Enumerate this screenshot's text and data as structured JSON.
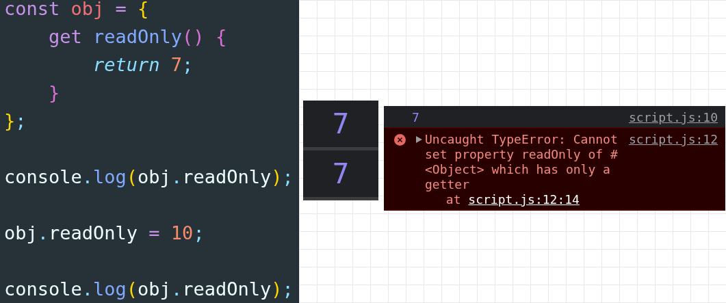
{
  "editor": {
    "lines": [
      {
        "kind": "code",
        "tokens": [
          {
            "text": "const",
            "kind": "keyword"
          },
          {
            "text": " obj",
            "kind": "variable"
          },
          {
            "text": " =",
            "kind": "operator"
          },
          {
            "text": " {",
            "kind": "bracket1"
          }
        ]
      },
      {
        "kind": "code",
        "tokens": [
          {
            "text": "    get",
            "kind": "keyword"
          },
          {
            "text": " readOnly",
            "kind": "function"
          },
          {
            "text": "()",
            "kind": "bracket2"
          },
          {
            "text": " {",
            "kind": "bracket2"
          }
        ]
      },
      {
        "kind": "code",
        "tokens": [
          {
            "text": "        return",
            "kind": "control"
          },
          {
            "text": " 7",
            "kind": "number"
          },
          {
            "text": ";",
            "kind": "punct"
          }
        ]
      },
      {
        "kind": "code",
        "tokens": [
          {
            "text": "    }",
            "kind": "bracket2"
          }
        ]
      },
      {
        "kind": "code",
        "tokens": [
          {
            "text": "}",
            "kind": "bracket1"
          },
          {
            "text": ";",
            "kind": "punct"
          }
        ]
      },
      {
        "kind": "blank"
      },
      {
        "kind": "code",
        "tokens": [
          {
            "text": "console",
            "kind": "plain"
          },
          {
            "text": ".",
            "kind": "punct"
          },
          {
            "text": "log",
            "kind": "function"
          },
          {
            "text": "(",
            "kind": "bracket1"
          },
          {
            "text": "obj",
            "kind": "plain"
          },
          {
            "text": ".",
            "kind": "punct"
          },
          {
            "text": "readOnly",
            "kind": "plain"
          },
          {
            "text": ")",
            "kind": "bracket1"
          },
          {
            "text": ";",
            "kind": "punct"
          }
        ]
      },
      {
        "kind": "blank"
      },
      {
        "kind": "code",
        "tokens": [
          {
            "text": "obj",
            "kind": "plain"
          },
          {
            "text": ".",
            "kind": "punct"
          },
          {
            "text": "readOnly",
            "kind": "plain"
          },
          {
            "text": " =",
            "kind": "operator"
          },
          {
            "text": " 10",
            "kind": "number"
          },
          {
            "text": ";",
            "kind": "punct"
          }
        ]
      },
      {
        "kind": "blank"
      },
      {
        "kind": "code",
        "tokens": [
          {
            "text": "console",
            "kind": "plain"
          },
          {
            "text": ".",
            "kind": "punct"
          },
          {
            "text": "log",
            "kind": "function"
          },
          {
            "text": "(",
            "kind": "bracket1"
          },
          {
            "text": "obj",
            "kind": "plain"
          },
          {
            "text": ".",
            "kind": "punct"
          },
          {
            "text": "readOnly",
            "kind": "plain"
          },
          {
            "text": ")",
            "kind": "bracket1"
          },
          {
            "text": ";",
            "kind": "punct"
          }
        ]
      }
    ]
  },
  "outputs": [
    {
      "value": "7"
    },
    {
      "value": "7"
    }
  ],
  "console": {
    "messages": [
      {
        "kind": "log",
        "text": "7",
        "source": "script.js:10"
      },
      {
        "kind": "error",
        "expandable": true,
        "text": "Uncaught TypeError: Cannot set property readOnly of #<Object> which has only a getter",
        "source": "script.js:12",
        "stack_prefix": "at",
        "stack_link": "script.js:12:14"
      }
    ]
  }
}
